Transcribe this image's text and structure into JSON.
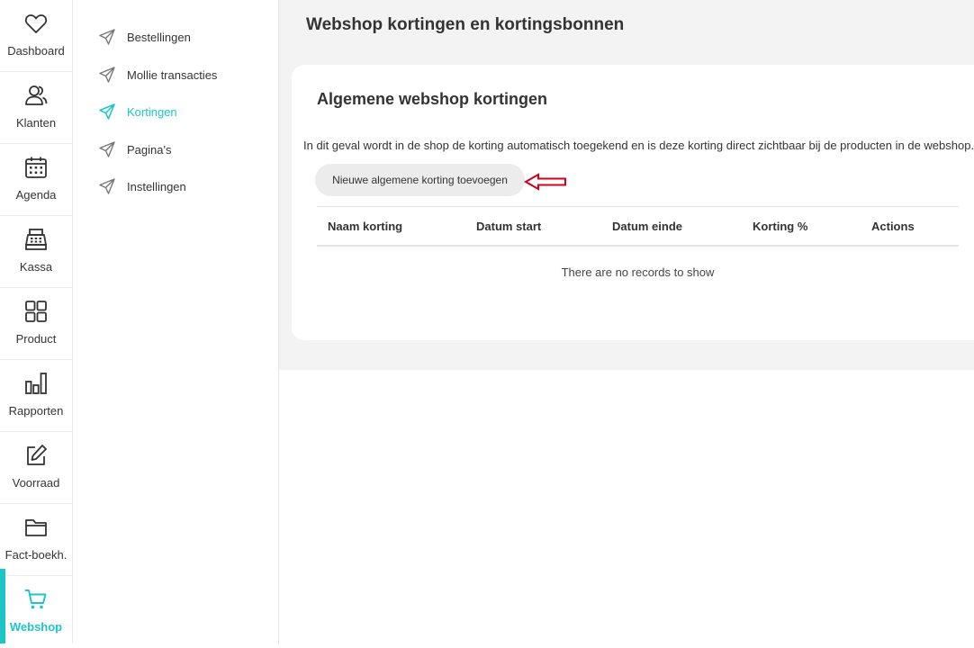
{
  "rail": {
    "items": [
      {
        "label": "Dashboard",
        "icon": "heart-icon"
      },
      {
        "label": "Klanten",
        "icon": "users-icon"
      },
      {
        "label": "Agenda",
        "icon": "calendar-icon"
      },
      {
        "label": "Kassa",
        "icon": "cash-register-icon"
      },
      {
        "label": "Product",
        "icon": "grid-icon"
      },
      {
        "label": "Rapporten",
        "icon": "bar-chart-icon"
      },
      {
        "label": "Voorraad",
        "icon": "edit-icon"
      },
      {
        "label": "Fact-boekh.",
        "icon": "folder-icon"
      },
      {
        "label": "Webshop",
        "icon": "cart-icon",
        "active": true
      }
    ],
    "accent": "#1cc6c6"
  },
  "subnav": {
    "items": [
      {
        "label": "Bestellingen"
      },
      {
        "label": "Mollie transacties"
      },
      {
        "label": "Kortingen",
        "active": true
      },
      {
        "label": "Pagina's"
      },
      {
        "label": "Instellingen"
      }
    ]
  },
  "page": {
    "title": "Webshop kortingen en kortingsbonnen"
  },
  "card": {
    "title": "Algemene webshop kortingen",
    "description": "In dit geval wordt in de shop de korting automatisch toegekend en is deze korting direct zichtbaar bij de producten in de webshop.",
    "add_button": "Nieuwe algemene korting toevoegen",
    "annotation_color": "#d0021b"
  },
  "table": {
    "columns": [
      "Naam korting",
      "Datum start",
      "Datum einde",
      "Korting %",
      "Actions"
    ],
    "empty_text": "There are no records to show"
  }
}
